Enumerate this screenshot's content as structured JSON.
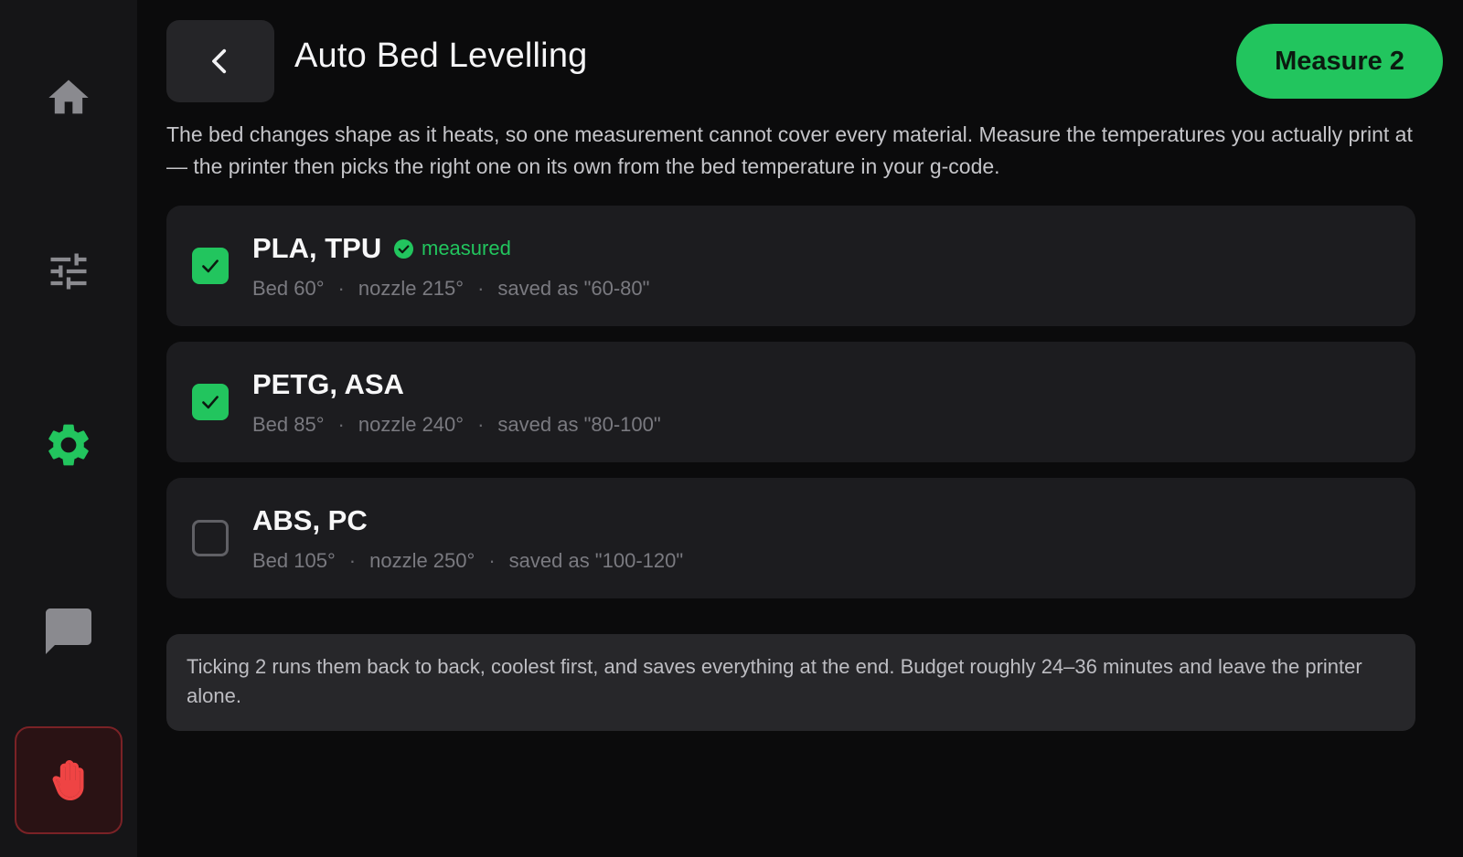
{
  "sidebar": {
    "items": [
      {
        "name": "home",
        "icon": "home-icon"
      },
      {
        "name": "tune",
        "icon": "sliders-icon"
      },
      {
        "name": "settings",
        "icon": "gear-icon",
        "active": true
      },
      {
        "name": "messages",
        "icon": "chat-icon"
      },
      {
        "name": "emergency-stop",
        "icon": "hand-stop-icon"
      }
    ]
  },
  "header": {
    "back_icon": "chevron-left-icon",
    "title": "Auto Bed Levelling",
    "action_label": "Measure 2"
  },
  "intro": "The bed changes shape as it heats, so one measurement cannot cover every material. Measure the temperatures you actually print at — the printer then picks the right one on its own from the bed temperature in your g-code.",
  "materials": [
    {
      "name": "PLA, TPU",
      "checked": true,
      "badge": "measured",
      "bed": "Bed 60°",
      "nozzle": "nozzle 215°",
      "saved": "saved as \"60-80\""
    },
    {
      "name": "PETG, ASA",
      "checked": true,
      "badge": "",
      "bed": "Bed 85°",
      "nozzle": "nozzle 240°",
      "saved": "saved as \"80-100\""
    },
    {
      "name": "ABS, PC",
      "checked": false,
      "badge": "",
      "bed": "Bed 105°",
      "nozzle": "nozzle 250°",
      "saved": "saved as \"100-120\""
    }
  ],
  "separator": "·",
  "info": "Ticking 2 runs them back to back, coolest first, and saves everything at the end. Budget roughly 24–36 minutes and leave the printer alone.",
  "colors": {
    "accent": "#22c55e",
    "background": "#0b0b0c",
    "sidebar": "#151517",
    "card": "#1c1c1f",
    "icon_inactive": "#8a8a8f",
    "danger": "#ef4444"
  }
}
